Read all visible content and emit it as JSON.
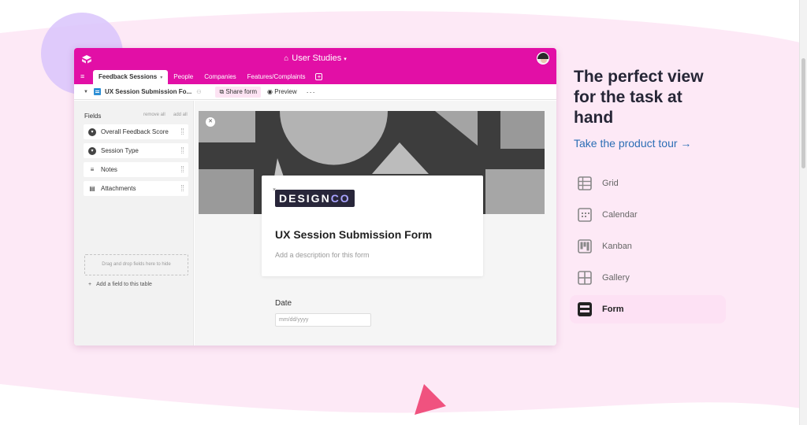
{
  "app": {
    "base_title": "User Studies",
    "tabs": [
      {
        "label": "Feedback Sessions",
        "active": true
      },
      {
        "label": "People"
      },
      {
        "label": "Companies"
      },
      {
        "label": "Features/Complaints"
      }
    ],
    "view_name": "UX Session Submission Fo...",
    "share_form_label": "Share form",
    "preview_label": "Preview",
    "more_label": "···"
  },
  "sidebar": {
    "title": "Fields",
    "remove_all": "remove all",
    "add_all": "add all",
    "fields": [
      {
        "label": "Overall Feedback Score",
        "icon": "single-select-icon"
      },
      {
        "label": "Session Type",
        "icon": "single-select-icon"
      },
      {
        "label": "Notes",
        "icon": "long-text-icon"
      },
      {
        "label": "Attachments",
        "icon": "attachment-icon"
      }
    ],
    "drop_hint": "Drag and drop fields here to hide",
    "add_field": "Add a field to this table"
  },
  "form": {
    "brand_part1": "DESIGN",
    "brand_part2": "CO",
    "title": "UX Session Submission Form",
    "description_placeholder": "Add a description for this form",
    "date_label": "Date",
    "date_placeholder": "mm/dd/yyyy"
  },
  "panel": {
    "headline_lines": [
      "The perfect view",
      "for the task at",
      "hand"
    ],
    "tour_link": "Take the product tour",
    "tour_arrow": "→",
    "views": [
      {
        "label": "Grid",
        "icon": "grid-icon"
      },
      {
        "label": "Calendar",
        "icon": "calendar-icon"
      },
      {
        "label": "Kanban",
        "icon": "kanban-icon"
      },
      {
        "label": "Gallery",
        "icon": "gallery-icon"
      },
      {
        "label": "Form",
        "icon": "form-icon",
        "active": true
      }
    ]
  },
  "colors": {
    "accent": "#e20fa6",
    "background_pink": "#fde9f6",
    "link": "#2c6eb5",
    "headline": "#262636"
  }
}
